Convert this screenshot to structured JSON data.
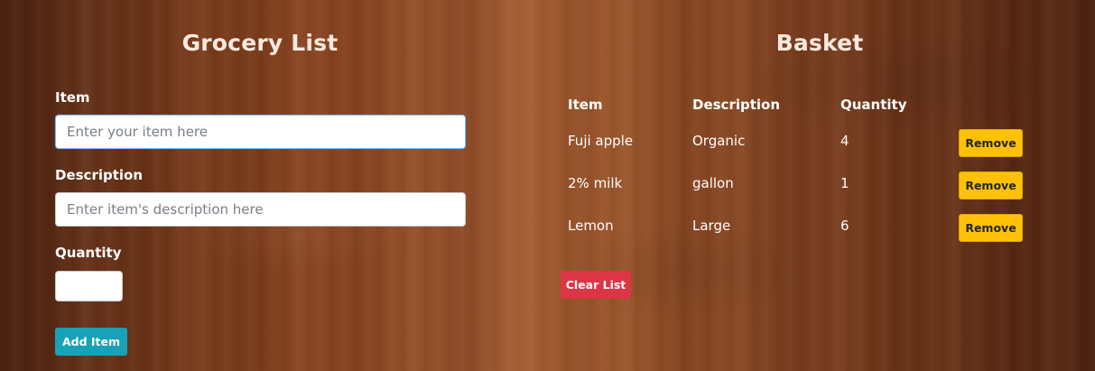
{
  "grocery_list": {
    "title": "Grocery List",
    "item_label": "Item",
    "item_placeholder": "Enter your item here",
    "item_value": "",
    "description_label": "Description",
    "description_placeholder": "Enter item's description here",
    "description_value": "",
    "quantity_label": "Quantity",
    "quantity_value": "",
    "add_button_label": "Add Item"
  },
  "basket": {
    "title": "Basket",
    "columns": [
      "Item",
      "Description",
      "Quantity"
    ],
    "rows": [
      {
        "item": "Fuji apple",
        "description": "Organic",
        "quantity": "4",
        "remove_label": "Remove"
      },
      {
        "item": "2% milk",
        "description": "gallon",
        "quantity": "1",
        "remove_label": "Remove"
      },
      {
        "item": "Lemon",
        "description": "Large",
        "quantity": "6",
        "remove_label": "Remove"
      }
    ],
    "clear_button_label": "Clear List"
  },
  "colors": {
    "add_button": "#17a2b8",
    "remove_button": "#ffc107",
    "clear_button": "#dc3545",
    "title_text": "#ffe9df"
  }
}
